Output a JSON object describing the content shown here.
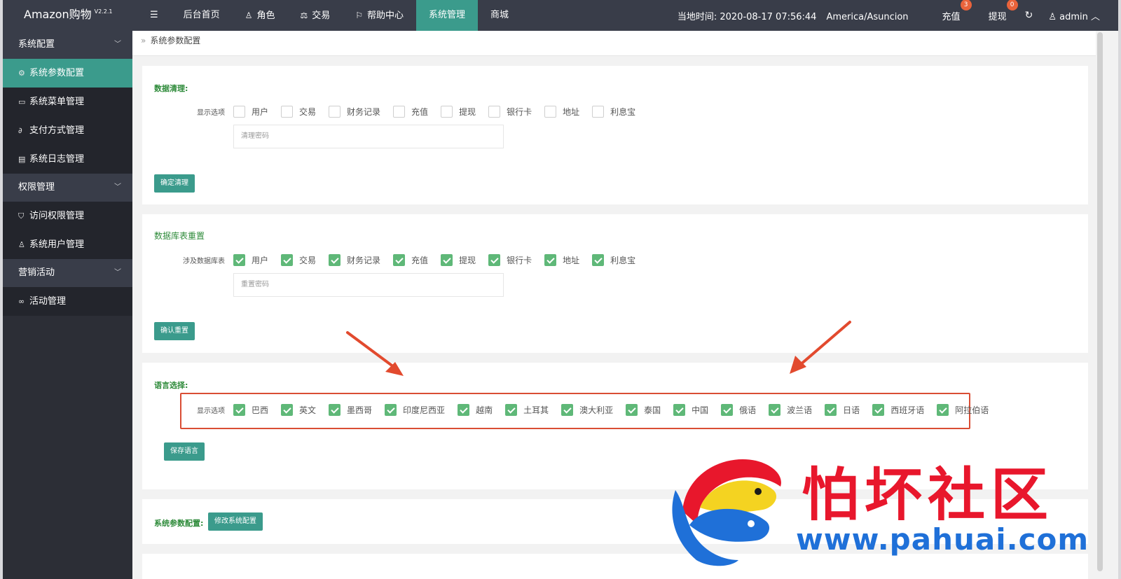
{
  "app": {
    "name": "Amazon购物",
    "version": "V2.2.1"
  },
  "topnav": {
    "menu_icon": "hamburger-icon",
    "items": [
      {
        "label": "后台首页",
        "icon": ""
      },
      {
        "label": "角色",
        "icon": "user-icon"
      },
      {
        "label": "交易",
        "icon": "scale-icon"
      },
      {
        "label": "帮助中心",
        "icon": "flag-icon"
      },
      {
        "label": "系统管理",
        "icon": "",
        "active": true
      },
      {
        "label": "商城",
        "icon": ""
      }
    ],
    "time_label": "当地时间:",
    "time_value": "2020-08-17 07:56:44",
    "timezone": "America/Asuncion",
    "recharge": {
      "label": "充值",
      "badge": "3"
    },
    "withdraw": {
      "label": "提现",
      "badge": "0"
    },
    "user": "admin"
  },
  "sidebar": {
    "groups": [
      {
        "label": "系统配置",
        "items": [
          {
            "label": "系统参数配置",
            "icon": "gear-icon",
            "active": true
          },
          {
            "label": "系统菜单管理",
            "icon": "window-icon"
          },
          {
            "label": "支付方式管理",
            "icon": "link-icon"
          },
          {
            "label": "系统日志管理",
            "icon": "document-icon"
          }
        ]
      },
      {
        "label": "权限管理",
        "items": [
          {
            "label": "访问权限管理",
            "icon": "shield-icon"
          },
          {
            "label": "系统用户管理",
            "icon": "user-icon"
          }
        ]
      },
      {
        "label": "营销活动",
        "items": [
          {
            "label": "活动管理",
            "icon": "infinity-icon"
          }
        ]
      }
    ]
  },
  "breadcrumb": {
    "current": "系统参数配置"
  },
  "data_clear": {
    "title": "数据清理:",
    "row_label": "显示选项",
    "options": [
      {
        "label": "用户",
        "checked": false
      },
      {
        "label": "交易",
        "checked": false
      },
      {
        "label": "财务记录",
        "checked": false
      },
      {
        "label": "充值",
        "checked": false
      },
      {
        "label": "提现",
        "checked": false
      },
      {
        "label": "银行卡",
        "checked": false
      },
      {
        "label": "地址",
        "checked": false
      },
      {
        "label": "利息宝",
        "checked": false
      }
    ],
    "password_placeholder": "清理密码",
    "button": "确定清理"
  },
  "db_reset": {
    "title": "数据库表重置",
    "row_label": "涉及数据库表",
    "options": [
      {
        "label": "用户",
        "checked": true
      },
      {
        "label": "交易",
        "checked": true
      },
      {
        "label": "财务记录",
        "checked": true
      },
      {
        "label": "充值",
        "checked": true
      },
      {
        "label": "提现",
        "checked": true
      },
      {
        "label": "银行卡",
        "checked": true
      },
      {
        "label": "地址",
        "checked": true
      },
      {
        "label": "利息宝",
        "checked": true
      }
    ],
    "password_placeholder": "重置密码",
    "button": "确认重置"
  },
  "language": {
    "title": "语言选择:",
    "row_label": "显示选项",
    "options": [
      {
        "label": "巴西",
        "checked": true
      },
      {
        "label": "英文",
        "checked": true
      },
      {
        "label": "墨西哥",
        "checked": true
      },
      {
        "label": "印度尼西亚",
        "checked": true
      },
      {
        "label": "越南",
        "checked": true
      },
      {
        "label": "土耳其",
        "checked": true
      },
      {
        "label": "澳大利亚",
        "checked": true
      },
      {
        "label": "泰国",
        "checked": true
      },
      {
        "label": "中国",
        "checked": true
      },
      {
        "label": "俄语",
        "checked": true
      },
      {
        "label": "波兰语",
        "checked": true
      },
      {
        "label": "日语",
        "checked": true
      },
      {
        "label": "西班牙语",
        "checked": true
      },
      {
        "label": "阿拉伯语",
        "checked": true
      }
    ],
    "button": "保存语言"
  },
  "sys_params": {
    "title": "系统参数配置:",
    "button": "修改系统配置"
  },
  "annotation_color": "#d94d34",
  "accent_color": "#3b9b8c",
  "watermark": {
    "title": "怕坏社区",
    "url": "www.pahuai.com"
  }
}
